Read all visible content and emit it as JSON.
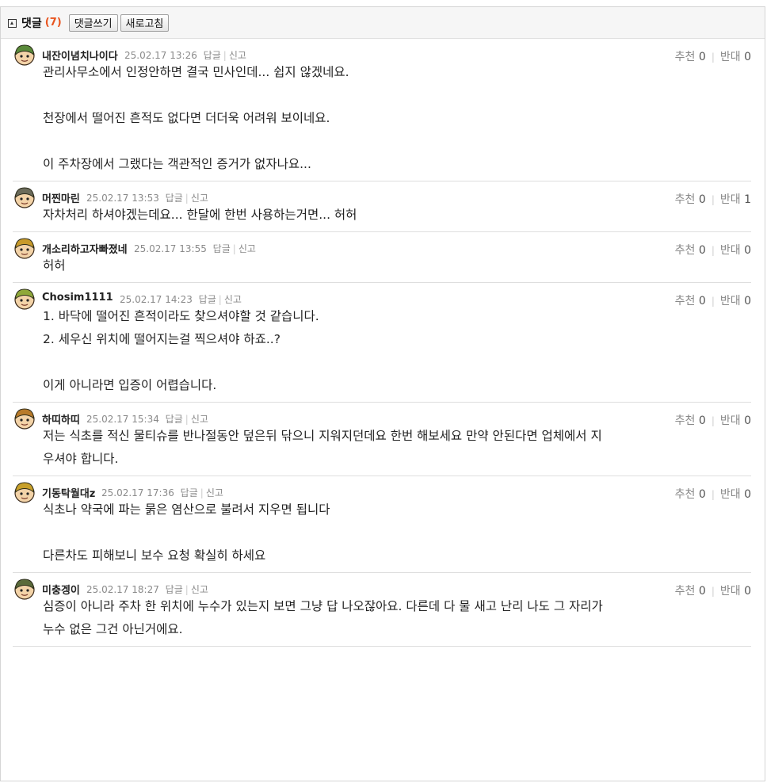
{
  "header": {
    "title": "댓글",
    "count": "(7)",
    "write_label": "댓글쓰기",
    "refresh_label": "새로고침"
  },
  "labels": {
    "reply": "답글",
    "report": "신고",
    "recommend": "추천",
    "oppose": "반대"
  },
  "comments": [
    {
      "nick": "내잔이념치나이다",
      "date": "25.02.17 13:26",
      "up": "0",
      "down": "0",
      "body": "관리사무소에서 인정안하면 결국 민사인데... 쉽지 않겠네요.\n\n천장에서 떨어진 흔적도 없다면 더더욱 어려워 보이네요.\n\n이 주차장에서 그랬다는 객관적인 증거가 없자나요...",
      "avatar_color": "#5a8a3a"
    },
    {
      "nick": "머찐마린",
      "date": "25.02.17 13:53",
      "up": "0",
      "down": "1",
      "body": "자차처리 하셔야겠는데요... 한달에 한번 사용하는거면... 허허",
      "avatar_color": "#6b6b5a"
    },
    {
      "nick": "개소리하고자빠졌네",
      "date": "25.02.17 13:55",
      "up": "0",
      "down": "0",
      "body": "허허",
      "avatar_color": "#c89a2a"
    },
    {
      "nick": "Chosim1111",
      "date": "25.02.17 14:23",
      "up": "0",
      "down": "0",
      "body": "1. 바닥에 떨어진 흔적이라도 찾으셔야할 것 같습니다.\n2. 세우신 위치에 떨어지는걸 찍으셔야 하죠..?\n\n이게 아니라면 입증이 어렵습니다.",
      "avatar_color": "#8fa83a"
    },
    {
      "nick": "하띠하띠",
      "date": "25.02.17 15:34",
      "up": "0",
      "down": "0",
      "body": "저는 식초를 적신 물티슈를 반나절동안 덮은뒤 닦으니 지워지던데요 한번 해보세요 만약 안된다면 업체에서 지\n우셔야 합니다.",
      "avatar_color": "#b87a2a"
    },
    {
      "nick": "기동탁월대z",
      "date": "25.02.17 17:36",
      "up": "0",
      "down": "0",
      "body": "식초나 약국에 파는 묽은 염산으로 불려서 지우면 됩니다\n\n다른차도 피해보니 보수 요청 확실히 하세요",
      "avatar_color": "#c8a02a"
    },
    {
      "nick": "미충겡이",
      "date": "25.02.17 18:27",
      "up": "0",
      "down": "0",
      "body": "심증이 아니라 주차 한 위치에 누수가 있는지 보면 그냥 답 나오잖아요. 다른데 다 물 새고 난리 나도 그 자리가\n누수 없은 그건 아닌거에요.",
      "avatar_color": "#5a6a3a"
    }
  ]
}
